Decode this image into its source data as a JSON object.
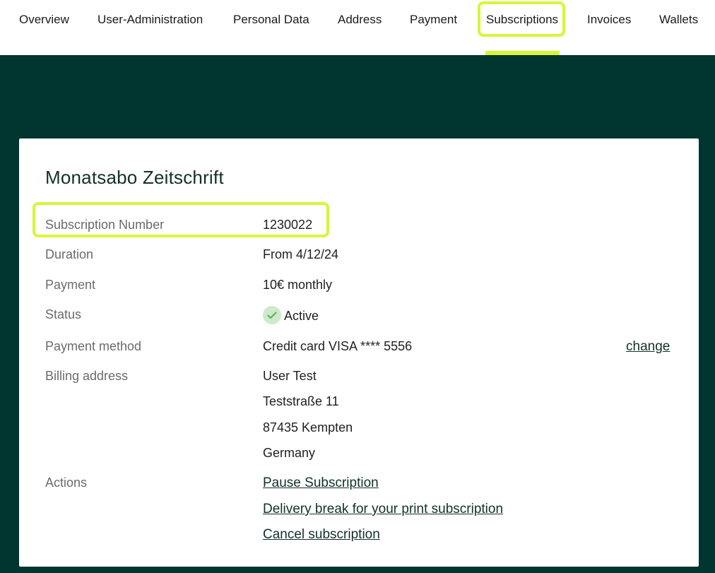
{
  "nav": {
    "items": [
      {
        "label": "Overview"
      },
      {
        "label": "User-Administration"
      },
      {
        "label": "Personal Data"
      },
      {
        "label": "Address"
      },
      {
        "label": "Payment"
      },
      {
        "label": "Subscriptions"
      },
      {
        "label": "Invoices"
      },
      {
        "label": "Wallets"
      }
    ],
    "active": "Subscriptions"
  },
  "colors": {
    "dark_green": "#003530",
    "highlight_lime": "#d8f53a",
    "status_green": "#cdeacb"
  },
  "subscription": {
    "title": "Monatsabo Zeitschrift",
    "fields": {
      "number_label": "Subscription Number",
      "number_value": "1230022",
      "duration_label": "Duration",
      "duration_value": "From 4/12/24",
      "payment_label": "Payment",
      "payment_value": "10€ monthly",
      "status_label": "Status",
      "status_value": "Active",
      "method_label": "Payment method",
      "method_value": "Credit card VISA **** 5556",
      "method_change": "change",
      "billing_label": "Billing address",
      "billing_lines": [
        "User Test",
        "Teststraße 11",
        "87435 Kempten",
        "Germany"
      ],
      "actions_label": "Actions"
    },
    "actions": [
      "Pause Subscription",
      "Delivery break for your print subscription",
      "Cancel subscription"
    ]
  }
}
